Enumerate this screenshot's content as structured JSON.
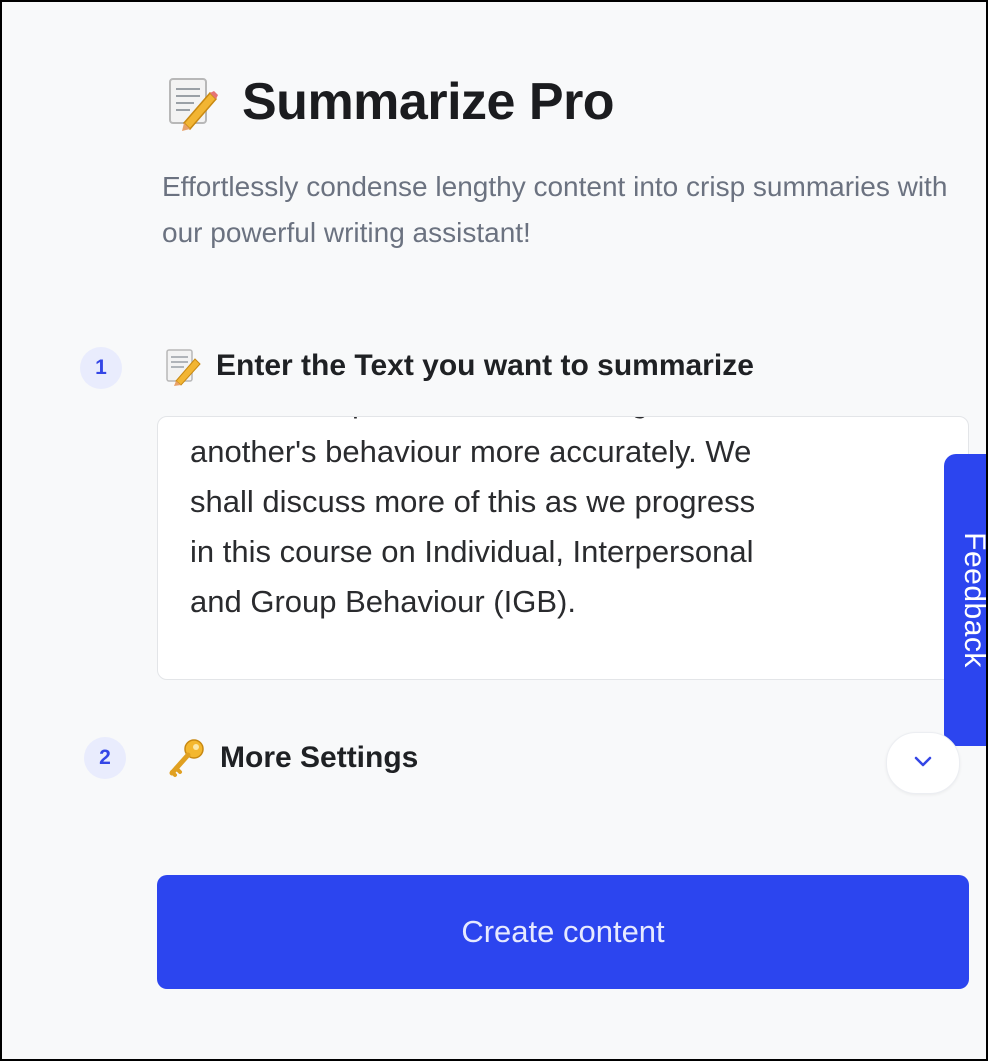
{
  "header": {
    "title": "Summarize Pro",
    "title_icon": "memo-icon",
    "subtitle": "Effortlessly condense lengthy content into crisp summaries with our powerful writing assistant!"
  },
  "steps": [
    {
      "number": "1",
      "icon": "memo-icon",
      "label": "Enter the Text you want to summarize",
      "textarea_value": "data will help us in understanding\nanother's behaviour more accurately. We\nshall discuss more of this as we progress\nin this course on Individual, Interpersonal\nand Group Behaviour (IGB)."
    },
    {
      "number": "2",
      "icon": "key-icon",
      "label": "More Settings",
      "expand_icon": "chevron-down-icon"
    }
  ],
  "actions": {
    "create_label": "Create content"
  },
  "feedback": {
    "label": "Feedback"
  },
  "colors": {
    "accent": "#2c45ef",
    "badge_bg": "#e9ecfd",
    "page_bg": "#f8f9fa"
  }
}
